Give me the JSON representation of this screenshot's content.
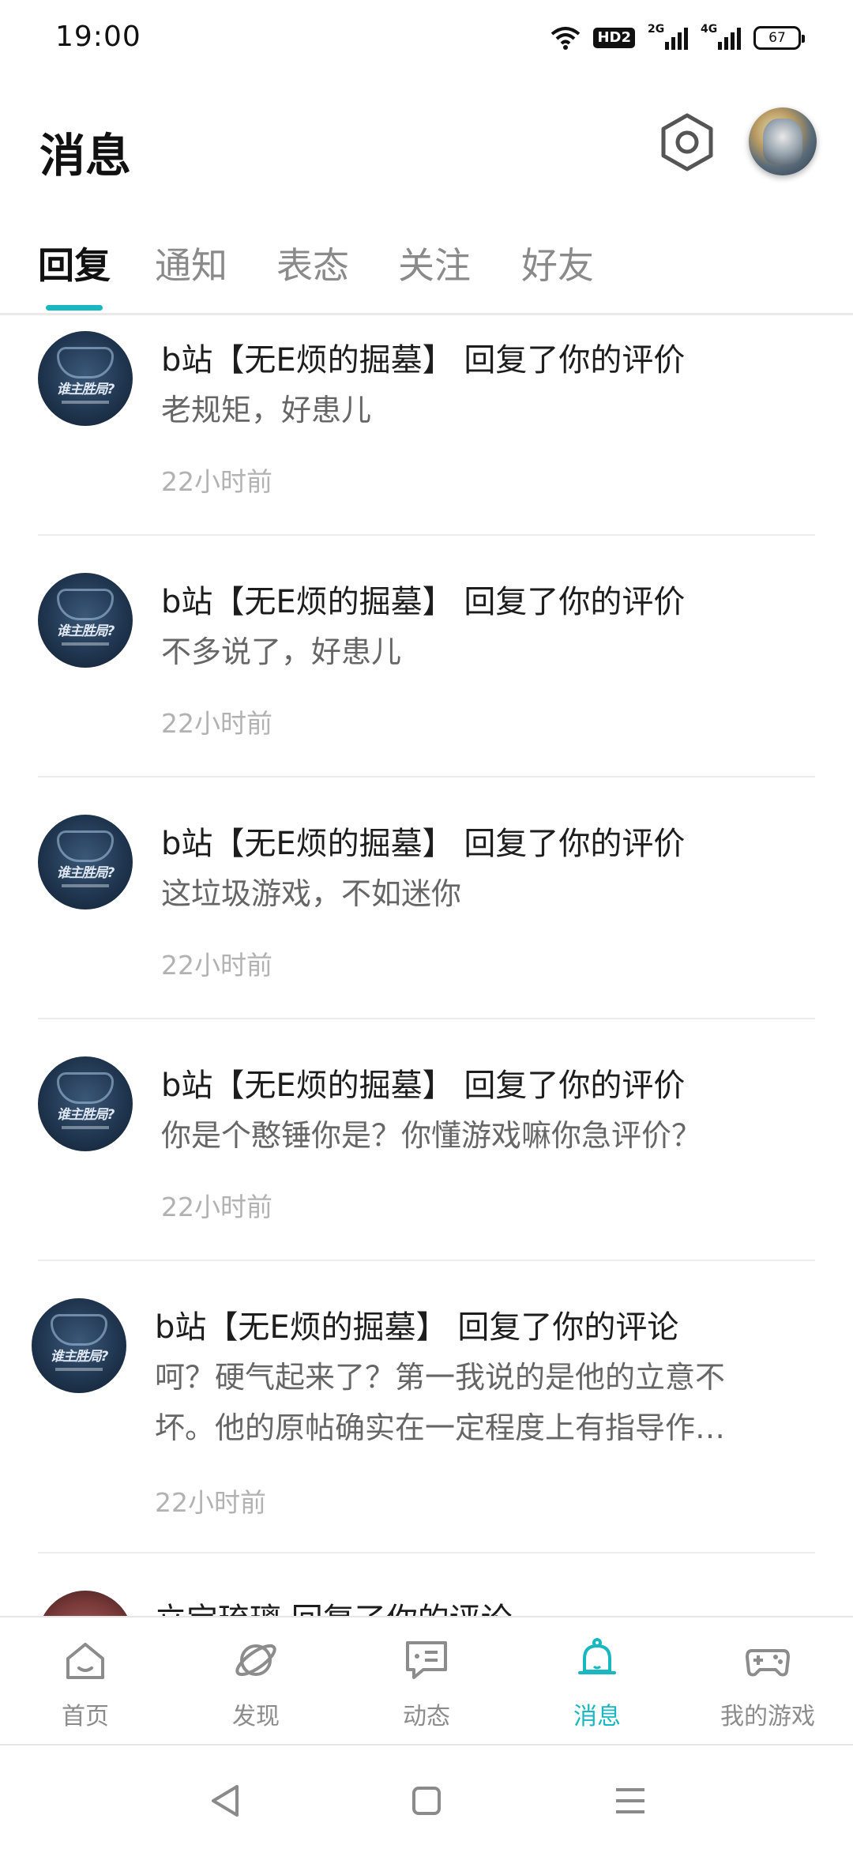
{
  "status_bar": {
    "time": "19:00",
    "hd_label": "HD2",
    "signal_1_label": "2G",
    "signal_2_label": "4G",
    "battery_level": "67"
  },
  "header": {
    "title": "消息",
    "settings_icon": "hexagon-gear-icon",
    "avatar_icon": "user-avatar"
  },
  "tabs": [
    {
      "label": "回复",
      "active": true
    },
    {
      "label": "通知",
      "active": false
    },
    {
      "label": "表态",
      "active": false
    },
    {
      "label": "关注",
      "active": false
    },
    {
      "label": "好友",
      "active": false
    }
  ],
  "messages": [
    {
      "title": "b站【无E烦的掘墓】 回复了你的评价",
      "body": "老规矩，好患儿",
      "time": "22小时前",
      "avatar_text": "谁主胜局?"
    },
    {
      "title": "b站【无E烦的掘墓】 回复了你的评价",
      "body": "不多说了，好患儿",
      "time": "22小时前",
      "avatar_text": "谁主胜局?"
    },
    {
      "title": "b站【无E烦的掘墓】 回复了你的评价",
      "body": "这垃圾游戏，不如迷你",
      "time": "22小时前",
      "avatar_text": "谁主胜局?"
    },
    {
      "title": "b站【无E烦的掘墓】 回复了你的评价",
      "body": "你是个憨锤你是？你懂游戏嘛你急评价？",
      "time": "22小时前",
      "avatar_text": "谁主胜局?"
    },
    {
      "title": "b站【无E烦的掘墓】 回复了你的评论",
      "body_line1": "呵？硬气起来了？第一我说的是他的立意不",
      "body_line2": "坏。他的原帖确实在一定程度上有指导作…",
      "time": "22小时前",
      "avatar_text": "谁主胜局?"
    },
    {
      "title": "立宝琉璃 回复了你的评论"
    }
  ],
  "bottom_nav": [
    {
      "label": "首页",
      "icon": "home-icon",
      "active": false
    },
    {
      "label": "发现",
      "icon": "planet-icon",
      "active": false
    },
    {
      "label": "动态",
      "icon": "chat-bubble-icon",
      "active": false
    },
    {
      "label": "消息",
      "icon": "bell-icon",
      "active": true
    },
    {
      "label": "我的游戏",
      "icon": "gamepad-icon",
      "active": false
    }
  ],
  "system_nav": {
    "back_icon": "back-triangle-icon",
    "home_icon": "home-square-icon",
    "menu_icon": "menu-lines-icon"
  },
  "colors": {
    "accent": "#19b7c0",
    "text_primary": "#1d1d1d",
    "text_secondary": "#666666",
    "text_muted": "#b2b2b2"
  }
}
